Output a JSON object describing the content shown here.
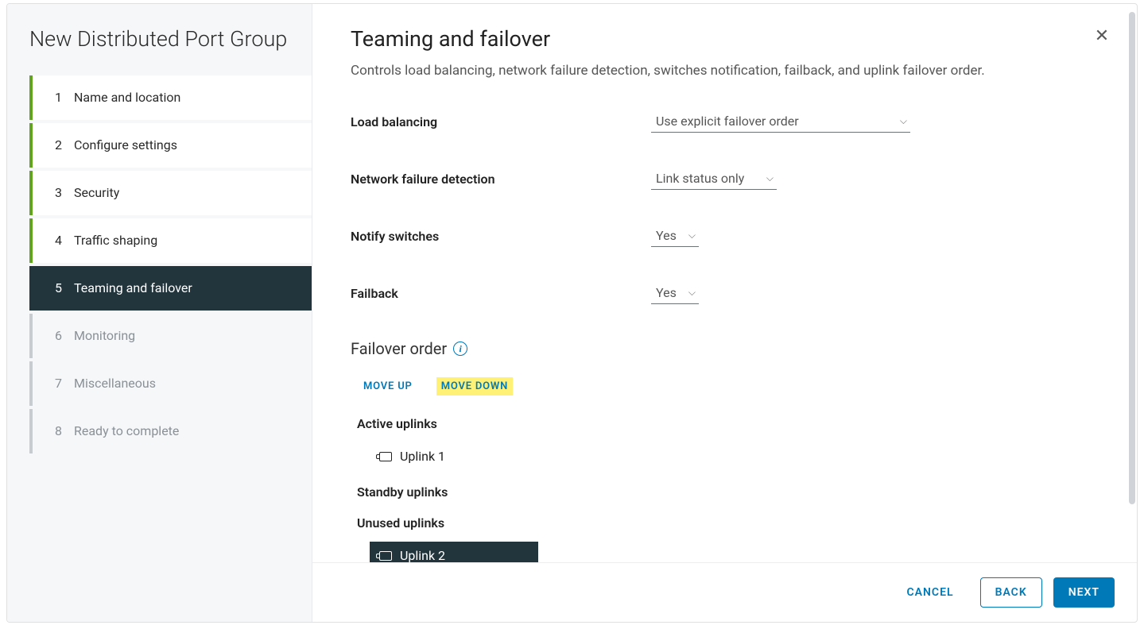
{
  "dialog_title": "New Distributed Port Group",
  "steps": [
    {
      "num": "1",
      "label": "Name and location",
      "state": "done"
    },
    {
      "num": "2",
      "label": "Configure settings",
      "state": "done"
    },
    {
      "num": "3",
      "label": "Security",
      "state": "done"
    },
    {
      "num": "4",
      "label": "Traffic shaping",
      "state": "done"
    },
    {
      "num": "5",
      "label": "Teaming and failover",
      "state": "active"
    },
    {
      "num": "6",
      "label": "Monitoring",
      "state": "future"
    },
    {
      "num": "7",
      "label": "Miscellaneous",
      "state": "future"
    },
    {
      "num": "8",
      "label": "Ready to complete",
      "state": "future"
    }
  ],
  "page": {
    "title": "Teaming and failover",
    "description": "Controls load balancing, network failure detection, switches notification, failback, and uplink failover order."
  },
  "form": {
    "load_balancing": {
      "label": "Load balancing",
      "value": "Use explicit failover order"
    },
    "failure_detect": {
      "label": "Network failure detection",
      "value": "Link status only"
    },
    "notify_switches": {
      "label": "Notify switches",
      "value": "Yes"
    },
    "failback": {
      "label": "Failback",
      "value": "Yes"
    }
  },
  "failover": {
    "section_label": "Failover order",
    "move_up": "MOVE UP",
    "move_down": "MOVE DOWN",
    "groups": {
      "active": {
        "label": "Active uplinks",
        "items": [
          "Uplink 1"
        ]
      },
      "standby": {
        "label": "Standby uplinks",
        "items": []
      },
      "unused": {
        "label": "Unused uplinks",
        "items": [
          "Uplink 2"
        ]
      }
    },
    "selected_item": "Uplink 2"
  },
  "footer": {
    "cancel": "CANCEL",
    "back": "BACK",
    "next": "NEXT"
  }
}
